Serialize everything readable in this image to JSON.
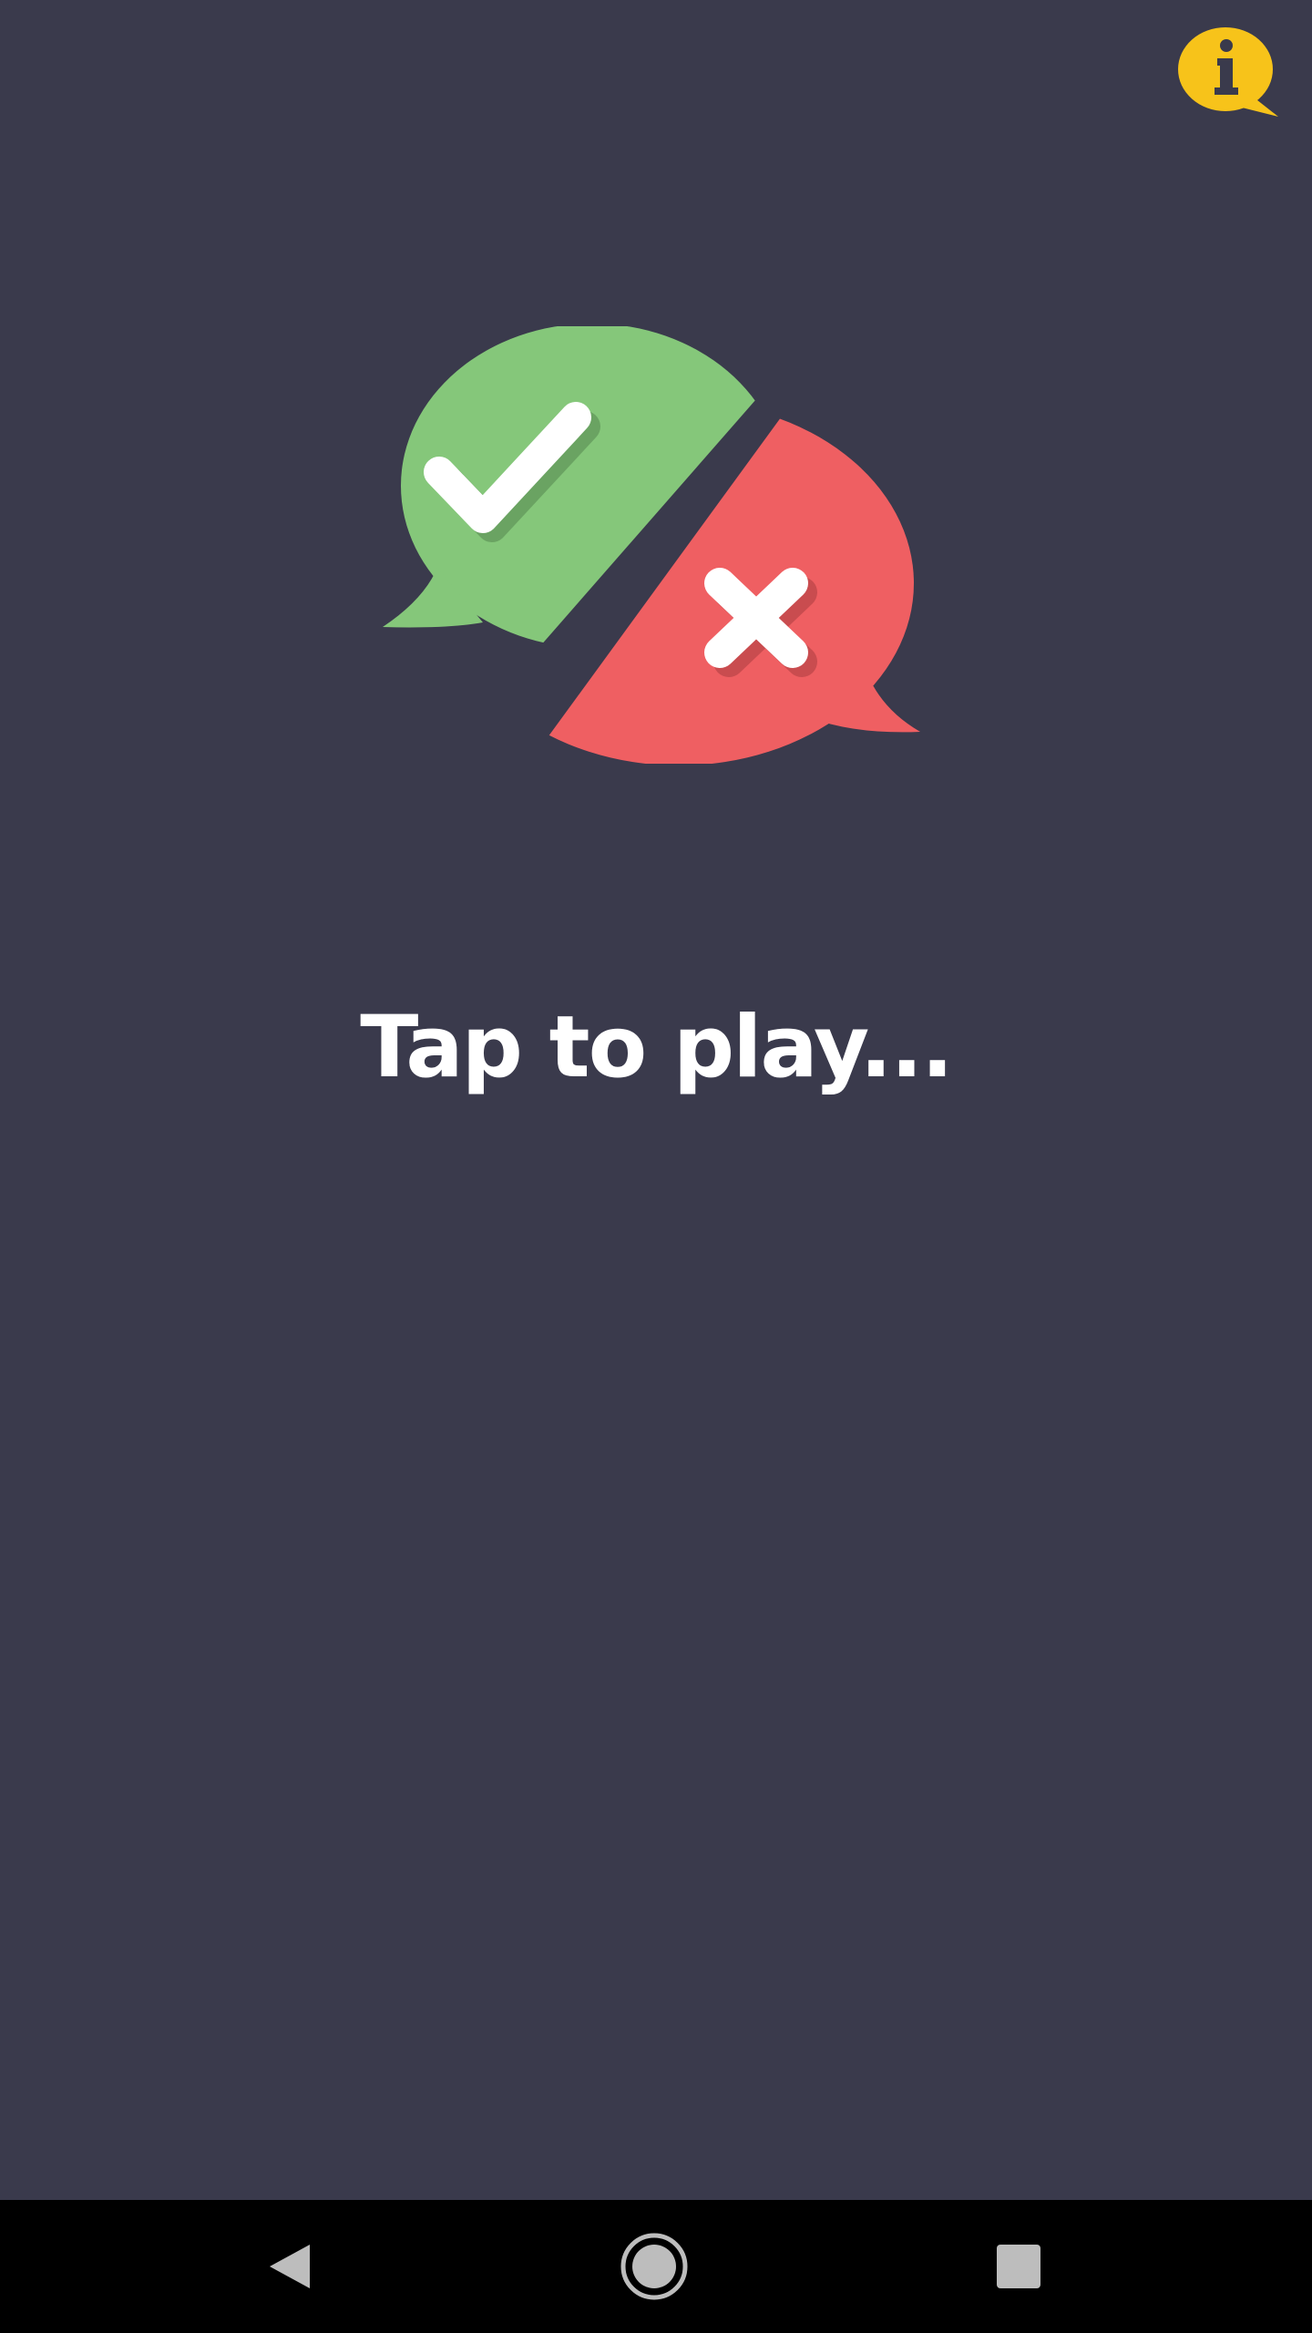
{
  "app": {
    "prompt_text": "Tap to play...",
    "background_color": "#3a3a4c"
  },
  "info_button": {
    "icon": "info-icon",
    "glyph": "i",
    "color": "#f7c31a"
  },
  "logo": {
    "left_bubble": {
      "icon": "checkmark-icon",
      "color": "#85c77a"
    },
    "right_bubble": {
      "icon": "cross-icon",
      "color": "#ef5f62"
    }
  },
  "navbar": {
    "buttons": [
      {
        "icon": "back-triangle-icon"
      },
      {
        "icon": "home-circle-icon"
      },
      {
        "icon": "recents-square-icon"
      }
    ],
    "color": "#000000",
    "icon_color": "#bdbdbd"
  }
}
